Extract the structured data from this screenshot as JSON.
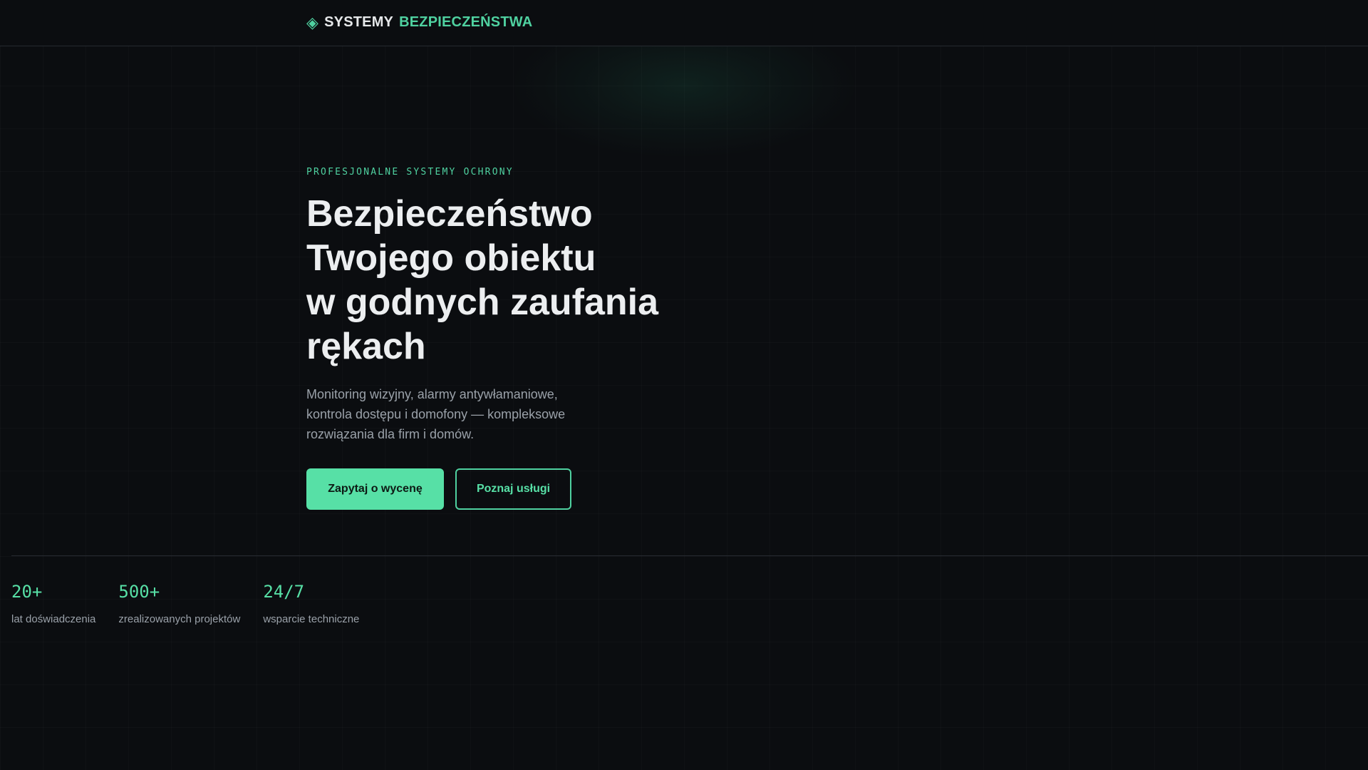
{
  "header": {
    "logo_icon": "diamond-icon",
    "brand_part1": "SYSTEMY",
    "brand_part2": "BEZPIECZEŃSTWA"
  },
  "hero": {
    "eyebrow": "PROFESJONALNE SYSTEMY OCHRONY",
    "title_lines": [
      "Bezpieczeństwo",
      "Twojego obiektu",
      "w godnych zaufania",
      "rękach"
    ],
    "description": "Monitoring wizyjny, alarmy antywłamaniowe, kontrola dostępu i domofony — kompleksowe rozwiązania dla firm i domów.",
    "cta_primary": "Zapytaj o wycenę",
    "cta_secondary": "Poznaj usługi"
  },
  "stats": [
    {
      "value": "20+",
      "label": "lat doświadczenia"
    },
    {
      "value": "500+",
      "label": "zrealizowanych projektów"
    },
    {
      "value": "24/7",
      "label": "wsparcie techniczne"
    }
  ],
  "colors": {
    "background": "#0b0d10",
    "accent": "#57e0a6",
    "text": "#eceef0",
    "muted": "#9aa1a9"
  }
}
